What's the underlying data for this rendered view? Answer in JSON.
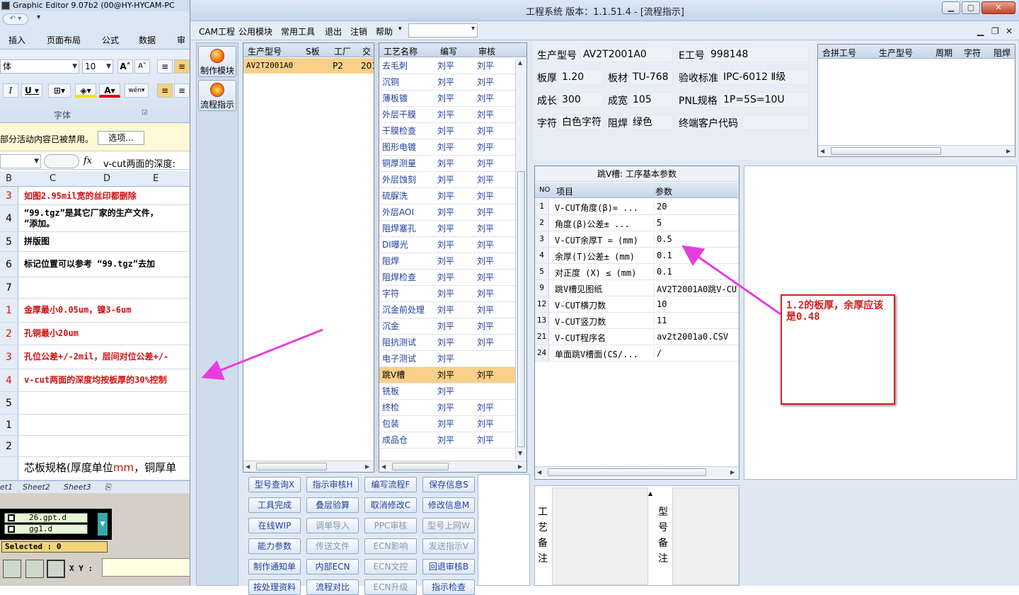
{
  "excel": {
    "title": "Graphic Editor 9.07b2 (00@HY-HYCAM-PC",
    "ribbon_tabs": [
      "插入",
      "页面布局",
      "公式",
      "数据",
      "审"
    ],
    "font_name": "体",
    "font_size": "10",
    "font_group_label": "字体",
    "security_msg": "部分活动内容已被禁用。",
    "options_button": "选项...",
    "formula_fx": "fx",
    "formula_text": "v-cut两面的深度:",
    "col_headers": [
      "B",
      "C",
      "D",
      "E"
    ],
    "rows": [
      {
        "n": "3",
        "text": "如图2.95mil宽的丝印都删除",
        "red": true
      },
      {
        "n": "4",
        "text": "“99.tgz”是其它厂家的生产文件，",
        "text2": "”添加。",
        "red": false
      },
      {
        "n": "5",
        "text": "拼版图",
        "red": false
      },
      {
        "n": "6",
        "text": "标记位置可以参考 “99.tgz”去加",
        "red": false
      },
      {
        "n": "7",
        "text": "",
        "red": false
      },
      {
        "n": "1",
        "text": "金厚最小0.05um，镍3-6um",
        "red": true
      },
      {
        "n": "2",
        "text": "孔铜最小20um",
        "red": true
      },
      {
        "n": "3",
        "text": "孔位公差+/-2mil，层间对位公差+/-",
        "red": true
      },
      {
        "n": "4",
        "text": "v-cut两面的深度均按板厚的30%控制",
        "red": true
      },
      {
        "n": "5",
        "text": "",
        "red": false
      },
      {
        "n": "1",
        "text": "",
        "red": false
      },
      {
        "n": "2",
        "text": "",
        "red": false
      },
      {
        "n": "",
        "text": "芯板规格(厚度单位",
        "text_red": "mm",
        "text3": "，铜厚单",
        "red": false
      }
    ],
    "sheet_tabs": [
      "et1",
      "Sheet2",
      "Sheet3"
    ],
    "cad_files": [
      "26.gpt.d",
      "gg1.d"
    ],
    "selected": "Selected : 0",
    "xy_label": "X Y :"
  },
  "app": {
    "title": "工程系统   版本：1.1.51.4 - [流程指示]",
    "menu": [
      "CAM工程",
      "公用模块",
      "常用工具",
      "退出",
      "注销",
      "帮助"
    ],
    "tools": [
      {
        "label": "制作模块",
        "icon": "fire-icon"
      },
      {
        "label": "流程指示",
        "icon": "orange-disc-icon"
      }
    ],
    "orders": {
      "columns": [
        "生产型号",
        "S板",
        "工厂",
        "交"
      ],
      "rows": [
        [
          "AV2T2001A0",
          "",
          "P2",
          "201"
        ]
      ]
    },
    "process": {
      "columns": [
        "工艺名称",
        "编写",
        "审核"
      ],
      "selected_index": 19,
      "rows": [
        [
          "去毛刺",
          "刘平",
          "刘平"
        ],
        [
          "沉铜",
          "刘平",
          "刘平"
        ],
        [
          "薄板镀",
          "刘平",
          "刘平"
        ],
        [
          "外层干膜",
          "刘平",
          "刘平"
        ],
        [
          "干膜检查",
          "刘平",
          "刘平"
        ],
        [
          "图形电镀",
          "刘平",
          "刘平"
        ],
        [
          "铜厚测量",
          "刘平",
          "刘平"
        ],
        [
          "外层蚀刻",
          "刘平",
          "刘平"
        ],
        [
          "硫脲洗",
          "刘平",
          "刘平"
        ],
        [
          "外层AOI",
          "刘平",
          "刘平"
        ],
        [
          "阻焊塞孔",
          "刘平",
          "刘平"
        ],
        [
          "DI曝光",
          "刘平",
          "刘平"
        ],
        [
          "阻焊",
          "刘平",
          "刘平"
        ],
        [
          "阻焊检查",
          "刘平",
          "刘平"
        ],
        [
          "字符",
          "刘平",
          "刘平"
        ],
        [
          "沉金前处理",
          "刘平",
          "刘平"
        ],
        [
          "沉金",
          "刘平",
          "刘平"
        ],
        [
          "阻抗测试",
          "刘平",
          "刘平"
        ],
        [
          "电子测试",
          "刘平",
          ""
        ],
        [
          "跳V槽",
          "刘平",
          "刘平"
        ],
        [
          "铣板",
          "刘平",
          ""
        ],
        [
          "终检",
          "刘平",
          "刘平"
        ],
        [
          "包装",
          "刘平",
          "刘平"
        ],
        [
          "成品仓",
          "刘平",
          "刘平"
        ]
      ]
    },
    "info": {
      "model_label": "生产型号",
      "model": "AV2T2001A0",
      "eno_label": "E工号",
      "eno": "998148",
      "thick_label": "板厚",
      "thick": "1.20",
      "material_label": "板材",
      "material": "TU-768",
      "std_label": "验收标准",
      "std": "IPC-6012 Ⅱ级",
      "len_label": "成长",
      "len": "300",
      "wid_label": "成宽",
      "wid": "105",
      "pnl_label": "PNL规格",
      "pnl": "1P=5S=10U",
      "char_label": "字符",
      "char": "白色字符",
      "mask_label": "阻焊",
      "mask": "绿色",
      "cust_label": "终端客户代码",
      "cust": ""
    },
    "merge": {
      "columns": [
        "合拼工号",
        "生产型号",
        "周期",
        "字符",
        "阻焊"
      ]
    },
    "param": {
      "title": "跳V槽: 工序基本参数",
      "columns": [
        "NO",
        "项目",
        "参数"
      ],
      "rows": [
        [
          "1",
          "V-CUT角度(β)=  ...",
          "20"
        ],
        [
          "2",
          "角度(β)公差±  ...",
          "5"
        ],
        [
          "3",
          "V-CUT余厚T =  (mm)",
          "0.5"
        ],
        [
          "4",
          "余厚(T)公差±  (mm)",
          "0.1"
        ],
        [
          "5",
          "对正度 (X) ≤ (mm)",
          "0.1"
        ],
        [
          "9",
          "跳V槽见图纸",
          "AV2T2001A0跳V-CUT"
        ],
        [
          "12",
          "V-CUT横刀数",
          "10"
        ],
        [
          "13",
          "V-CUT竖刀数",
          "11"
        ],
        [
          "21",
          "V-CUT程序名",
          "av2t2001a0.CSV"
        ],
        [
          "24",
          "单面跳V槽面(CS/...",
          "/"
        ]
      ]
    },
    "buttons": [
      [
        "型号查询X",
        "指示审核H",
        "编写流程F",
        "保存信息S"
      ],
      [
        "工具完成",
        "叠层验算",
        "取消修改C",
        "修改信息M"
      ],
      [
        "在线WIP",
        "调单导入",
        "PPC审核",
        "型号上网W"
      ],
      [
        "能力参数",
        "传送文件",
        "ECN影响",
        "发送指示V"
      ],
      [
        "制作通知单",
        "内部ECN",
        "ECN文控",
        "回退审核B"
      ],
      [
        "按处理资料",
        "流程对比",
        "ECN升级",
        "指示检查"
      ]
    ],
    "disabled_buttons": [
      "调单导入",
      "PPC审核",
      "型号上网W",
      "传送文件",
      "ECN影响",
      "发送指示V",
      "ECN文控",
      "ECN升级"
    ],
    "remark1": "工艺备注",
    "remark2": "型号备注",
    "callout": "1.2的板厚，余厚应该是0.48",
    "colors": {
      "annotation": "#d42020",
      "arrow": "#e83ce0",
      "selected_row": "#f9d08a"
    }
  }
}
